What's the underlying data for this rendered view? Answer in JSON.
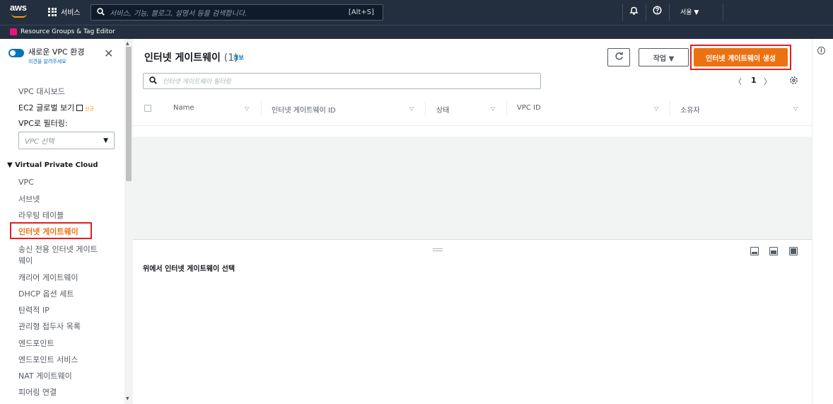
{
  "topnav": {
    "logo": "aws",
    "services_label": "서비스",
    "search_placeholder": "서비스, 기능, 블로그, 설명서 등을 검색합니다.",
    "search_shortcut": "[Alt+S]",
    "region": "서울 ▼"
  },
  "subnav": {
    "resource_groups": "Resource Groups & Tag Editor"
  },
  "sidebar": {
    "new_vpc_label": "새로운 VPC 환경",
    "feedback_label": "의견을 알려주세요",
    "dashboard": "VPC 대시보드",
    "ec2_global_view": "EC2 글로벌 보기",
    "new_badge": "신규",
    "filter_by_vpc": "VPC로 필터링:",
    "vpc_select_placeholder": "VPC 선택",
    "section_title": "Virtual Private Cloud",
    "items": [
      "VPC",
      "서브넷",
      "라우팅 테이블",
      "인터넷 게이트웨이",
      "송신 전용 인터넷 게이트",
      "웨이",
      "캐리어 게이트웨이",
      "DHCP 옵션 세트",
      "탄력적 IP",
      "관리형 접두사 목록",
      "엔드포인트",
      "엔드포인트 서비스",
      "NAT 게이트웨이",
      "피어링 연결"
    ]
  },
  "main": {
    "title": "인터넷 게이트웨이",
    "count": "(1)",
    "info": "정보",
    "actions_label": "작업 ▼",
    "create_label": "인터넷 게이트웨이 생성",
    "filter_placeholder": "인터넷 게이트웨이 필터링",
    "pager_prev": "〈",
    "page": "1",
    "pager_next": "〉",
    "columns": [
      "Name",
      "인터넷 게이트웨이 ID",
      "상태",
      "VPC ID",
      "소유자"
    ],
    "select_message": "위에서 인터넷 게이트웨이 선택"
  },
  "colors": {
    "nav_bg": "#232f3e",
    "accent": "#ec7211",
    "highlight": "#e02020",
    "link": "#0073bb"
  },
  "icons": [
    "grid-icon",
    "search-icon",
    "bell-icon",
    "help-icon",
    "refresh-icon",
    "gear-icon",
    "external-link-icon",
    "info-icon"
  ]
}
